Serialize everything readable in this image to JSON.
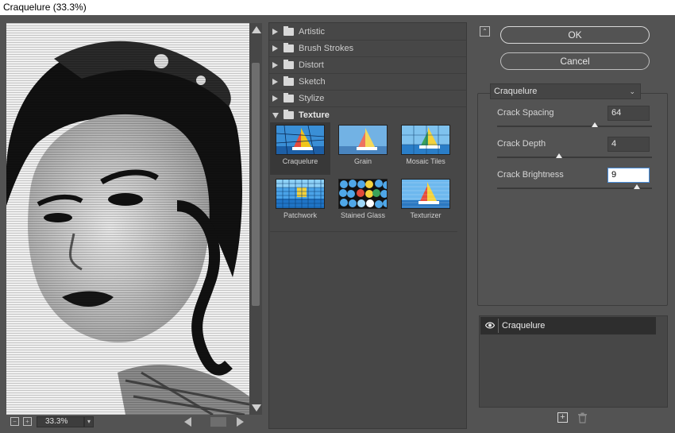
{
  "window": {
    "title": "Craquelure (33.3%)"
  },
  "preview": {
    "zoom": "33.3%"
  },
  "gallery": {
    "categories": [
      {
        "label": "Artistic",
        "expanded": false
      },
      {
        "label": "Brush Strokes",
        "expanded": false
      },
      {
        "label": "Distort",
        "expanded": false
      },
      {
        "label": "Sketch",
        "expanded": false
      },
      {
        "label": "Stylize",
        "expanded": false
      },
      {
        "label": "Texture",
        "expanded": true
      }
    ],
    "filters": [
      {
        "label": "Craquelure",
        "selected": true
      },
      {
        "label": "Grain",
        "selected": false
      },
      {
        "label": "Mosaic Tiles",
        "selected": false
      },
      {
        "label": "Patchwork",
        "selected": false
      },
      {
        "label": "Stained Glass",
        "selected": false
      },
      {
        "label": "Texturizer",
        "selected": false
      }
    ]
  },
  "buttons": {
    "ok": "OK",
    "cancel": "Cancel"
  },
  "settings": {
    "filter_select": "Craquelure",
    "params": [
      {
        "label": "Crack Spacing",
        "value": "64",
        "min": 2,
        "max": 100
      },
      {
        "label": "Crack Depth",
        "value": "4",
        "min": 0,
        "max": 10
      },
      {
        "label": "Crack Brightness",
        "value": "9",
        "min": 0,
        "max": 10
      }
    ]
  },
  "layers": {
    "items": [
      {
        "label": "Craquelure",
        "visible": true
      }
    ]
  },
  "icons": [
    "collapse-icon",
    "folder-icon",
    "eye-icon",
    "new-layer-icon",
    "trash-icon"
  ]
}
